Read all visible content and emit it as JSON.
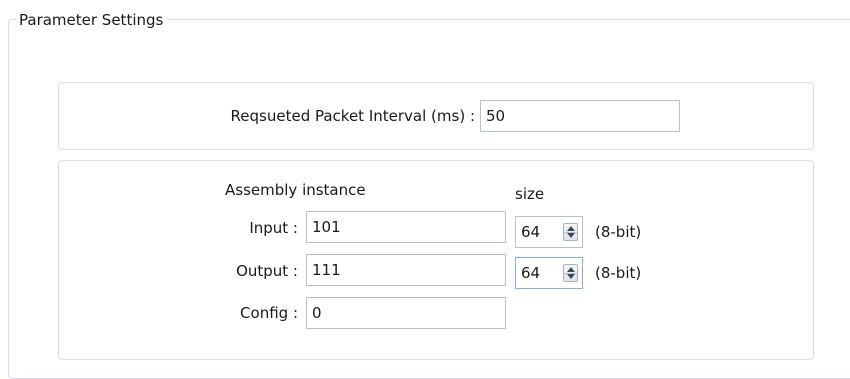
{
  "group": {
    "title": "Parameter Settings"
  },
  "rpi": {
    "label": "Reqsueted Packet Interval (ms) :",
    "value": "50"
  },
  "assembly": {
    "header_instance": "Assembly instance",
    "header_size": "size",
    "rows": [
      {
        "label": "Input :",
        "instance": "101",
        "size": "64",
        "unit": "(8-bit)"
      },
      {
        "label": "Output :",
        "instance": "111",
        "size": "64",
        "unit": "(8-bit)"
      },
      {
        "label": "Config :",
        "instance": "0"
      }
    ]
  }
}
